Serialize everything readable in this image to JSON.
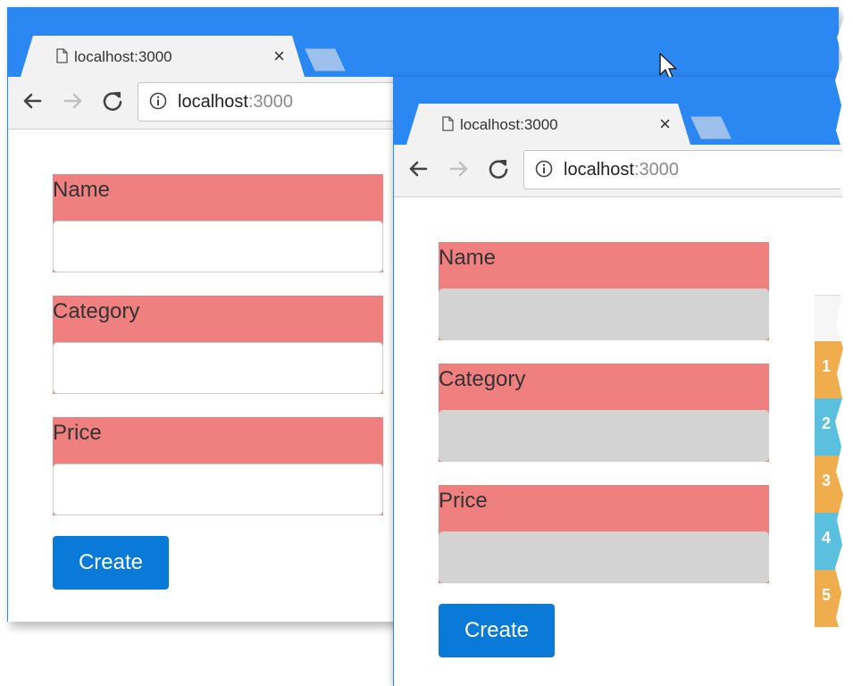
{
  "colors": {
    "tabstrip": "#2b88f2",
    "label_bg": "#f08080",
    "input_disabled_bg": "#d3d3d3",
    "primary_button": "#0a7ad8",
    "badge_warning": "#f0ad4e",
    "badge_info": "#5bc0de"
  },
  "window_back": {
    "tab": {
      "title": "localhost:3000",
      "close": "×",
      "icon": "page-icon"
    },
    "address": {
      "host": "localhost",
      "port": ":3000",
      "icon": "info-icon"
    },
    "form": {
      "name_label": "Name",
      "category_label": "Category",
      "price_label": "Price",
      "name_value": "",
      "category_value": "",
      "price_value": "",
      "submit_label": "Create"
    }
  },
  "window_front": {
    "tab": {
      "title": "localhost:3000",
      "close": "×",
      "icon": "page-icon"
    },
    "address": {
      "host": "localhost",
      "port": ":3000",
      "icon": "info-icon"
    },
    "form": {
      "name_label": "Name",
      "category_label": "Category",
      "price_label": "Price",
      "name_value": "",
      "category_value": "",
      "price_value": "",
      "submit_label": "Create"
    }
  },
  "side_badges": [
    "1",
    "2",
    "3",
    "4",
    "5"
  ]
}
